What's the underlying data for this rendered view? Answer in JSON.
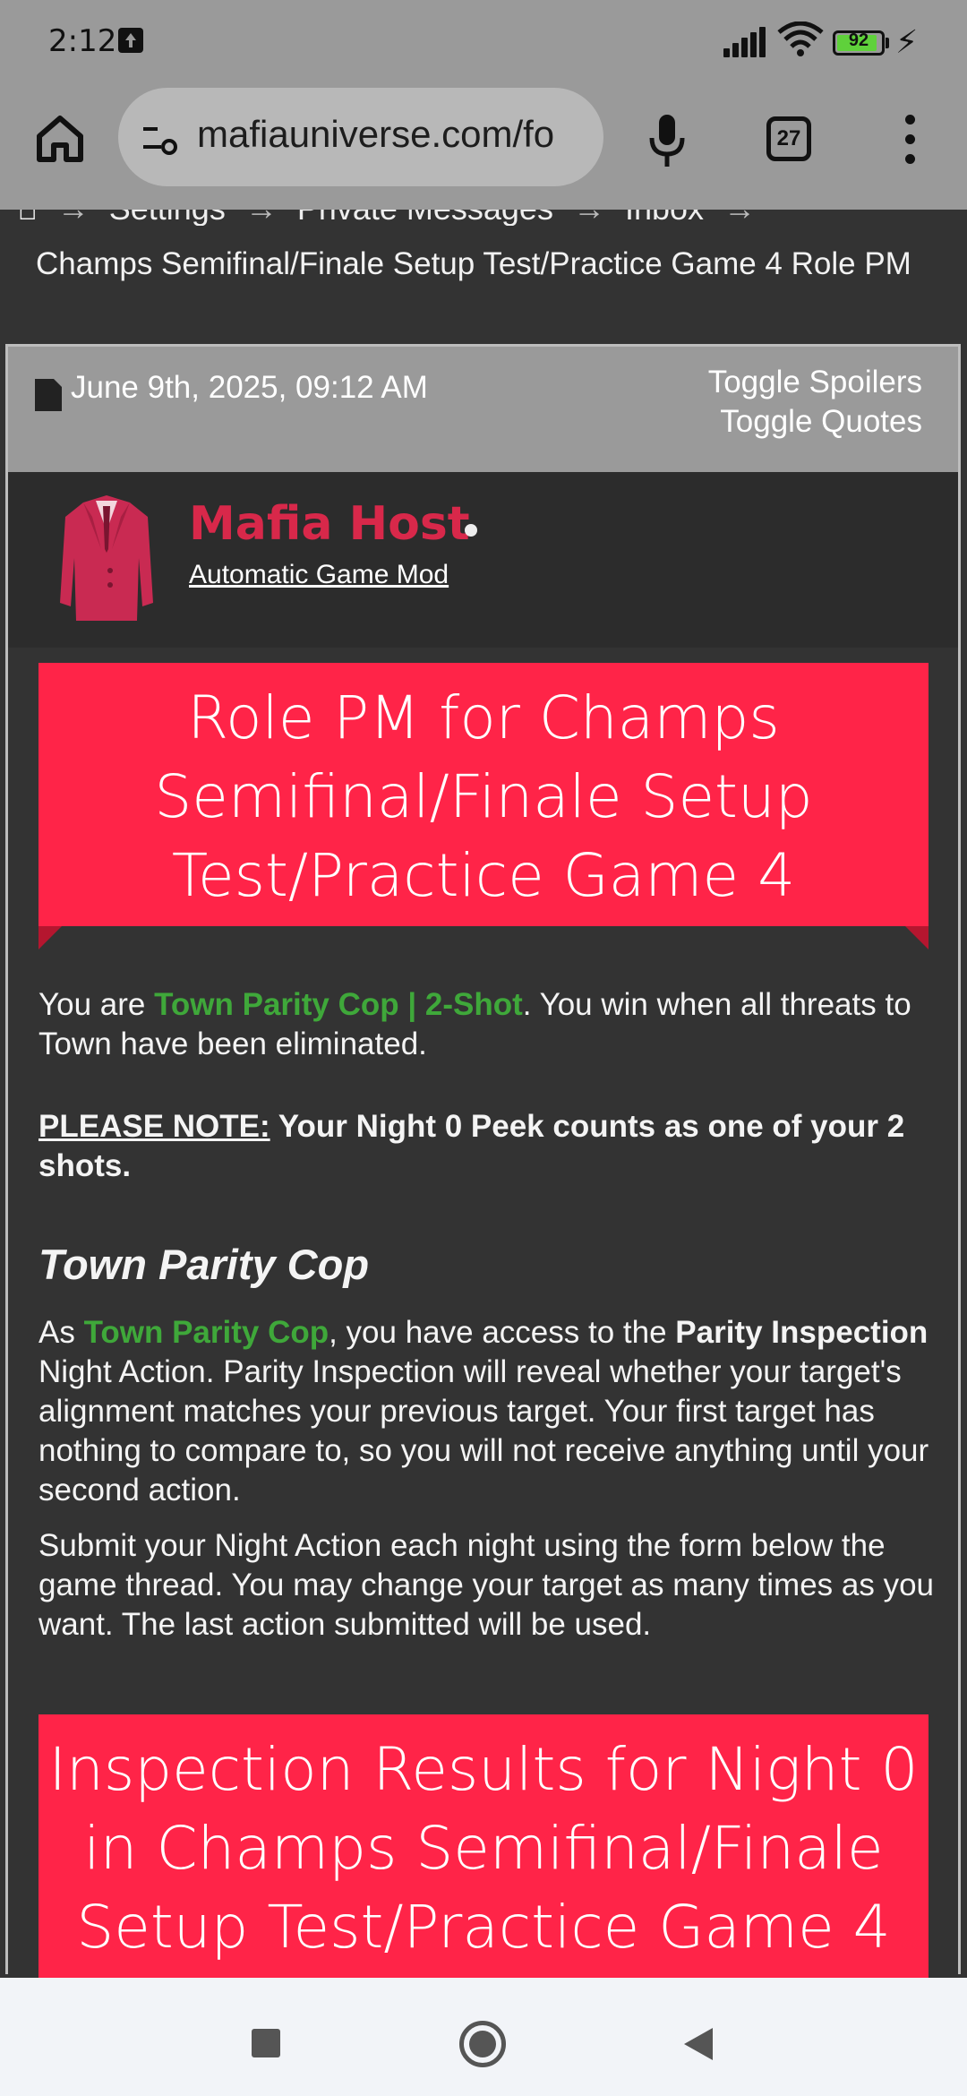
{
  "status_bar": {
    "time": "2:12",
    "battery_level": "92",
    "battery_fraction": 0.92
  },
  "browser": {
    "url": "mafiauniverse.com/fo",
    "tab_count": "27"
  },
  "breadcrumb": {
    "items": [
      "Settings",
      "Private Messages",
      "Inbox"
    ],
    "separator": "→"
  },
  "thread_title": "Champs Semifinal/Finale Setup Test/Practice Game 4 Role PM",
  "post": {
    "date": "June 9th, 2025, 09:12 AM",
    "toggle_spoilers": "Toggle Spoilers",
    "toggle_quotes": "Toggle Quotes",
    "user_name": "Mafia Host",
    "user_title": "Automatic Game Mod",
    "banner_title": "Role PM for Champs Semifinal/Finale Setup Test/Practice Game 4",
    "intro_prefix": "You are ",
    "role_full": "Town Parity Cop | 2-Shot",
    "intro_suffix": ". You win when all threats to Town have been eliminated.",
    "note_label": "PLEASE NOTE:",
    "note_text": " Your Night 0 Peek counts as one of your 2 shots.",
    "role_heading": "Town Parity Cop",
    "desc_as": "As ",
    "role_name": "Town Parity Cop",
    "desc_mid": ", you have access to the ",
    "action_name": "Parity Inspection",
    "desc_rest": " Night Action. Parity Inspection will reveal whether your target's alignment matches your previous target. Your first target has nothing to compare to, so you will not receive anything until your second action.",
    "submit_text": "Submit your Night Action each night using the form below the game thread. You may change your target as many times as you want. The last action submitted will be used.",
    "banner_2_title": "Inspection Results for Night 0 in Champs Semifinal/Finale Setup Test/Practice Game 4"
  },
  "colors": {
    "accent_red": "#ff2448",
    "role_green": "#3fa83a",
    "username_red": "#d8284a"
  },
  "icons": [
    "upload-icon",
    "signal-icon",
    "wifi-icon",
    "battery-icon",
    "charging-icon",
    "home-icon",
    "tune-icon",
    "mic-icon",
    "tabs-icon",
    "more-vert-icon",
    "document-icon",
    "suit-avatar-icon",
    "recents-icon",
    "home-nav-icon",
    "back-icon"
  ]
}
